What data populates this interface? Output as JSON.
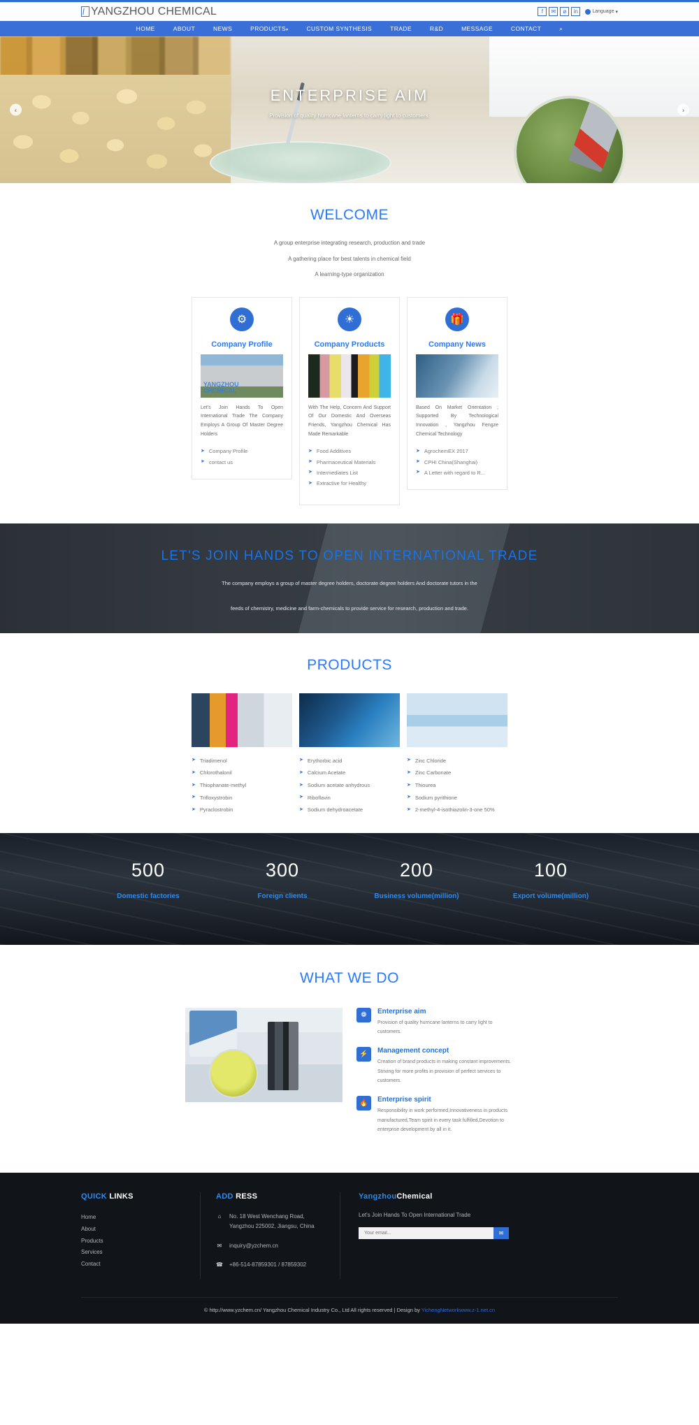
{
  "header": {
    "logo_text": "YANGZHOU CHEMICAL",
    "logo_icon": "document-pen-icon",
    "social": [
      {
        "name": "facebook-icon",
        "glyph": "f"
      },
      {
        "name": "twitter-icon",
        "glyph": "✉"
      },
      {
        "name": "pinterest-icon",
        "glyph": "ø"
      },
      {
        "name": "linkedin-icon",
        "glyph": "in"
      }
    ],
    "language_label": "Language",
    "language_caret": "▾"
  },
  "nav": {
    "items": [
      {
        "label": "HOME"
      },
      {
        "label": "ABOUT"
      },
      {
        "label": "NEWS"
      },
      {
        "label": "PRODUCTS",
        "caret": "▾"
      },
      {
        "label": "CUSTOM SYNTHESIS"
      },
      {
        "label": "TRADE"
      },
      {
        "label": "R&D"
      },
      {
        "label": "MESSAGE"
      },
      {
        "label": "CONTACT"
      }
    ],
    "search_icon": "⌕"
  },
  "hero": {
    "title": "ENTERPRISE AIM",
    "subtitle": "Provision of quality hurricane lanterns to carry light to customers.",
    "prev": "‹",
    "next": "›"
  },
  "welcome": {
    "title": "WELCOME",
    "lines": [
      "A group enterprise integrating research, production and trade",
      "A gathering place for best talents in chemical field",
      "A learning-type organization"
    ]
  },
  "cards": [
    {
      "icon": "gear-icon",
      "glyph": "⚙",
      "title": "Company Profile",
      "image": "office-building-photo",
      "desc": "Let's Join Hands To Open International Trade The Company Employs A Group Of Master Degree Holders",
      "links": [
        "Company Profile",
        "contact us"
      ]
    },
    {
      "icon": "sun-gear-icon",
      "glyph": "☀",
      "title": "Company Products",
      "image": "colorful-flasks-photo",
      "desc": "With The Help, Concern And Support Of Our Domestic And Overseas Friends, Yangzhou Chemical Has Made Remarkable",
      "links": [
        "Food Additives",
        "Pharmaceutical Materials",
        "Intermediates List",
        "Extractive for Healthy"
      ]
    },
    {
      "icon": "gift-icon",
      "glyph": "🎁",
      "title": "Company News",
      "image": "lab-glassware-photo",
      "desc": "Based On Market Orientation ; Supported By Technological Innovation , Yangzhou Fengze Chemical Technology",
      "links": [
        "AgrochemEX 2017",
        "CPHI China(Shanghai)",
        "A Letter with regard to R..."
      ]
    }
  ],
  "banner": {
    "title": "LET'S JOIN HANDS TO OPEN INTERNATIONAL TRADE",
    "lines": [
      "The company employs a group of master degree holders, doctorate degree holders And doctorate tutors in the",
      "feeds of chemistry, medicine and farm-chemicals to provide service for research, production and trade."
    ]
  },
  "products": {
    "title": "PRODUCTS",
    "columns": [
      {
        "image": "test-tubes-photo",
        "items": [
          "Triadimenol",
          "Chlorothalonil",
          "Thiophanate-methyl",
          "Trifloxystrobin",
          "Pyraclostrobin"
        ]
      },
      {
        "image": "gloved-hand-flask-photo",
        "items": [
          "Erythorbic acid",
          "Calcium Acetate",
          "Sodium acetate anhydrous",
          "Riboflavin",
          "Sodium dehydroacetate"
        ]
      },
      {
        "image": "plant-test-tubes-photo",
        "items": [
          "Zinc Chloride",
          "Zinc Carbonate",
          "Thiourea",
          "Sodium pyrithione",
          "2-methyl-4-isothiazolin-3-one 50%"
        ]
      }
    ]
  },
  "stats": [
    {
      "number": "500",
      "label": "Domestic factories"
    },
    {
      "number": "300",
      "label": "Foreign clients"
    },
    {
      "number": "200",
      "label": "Business volume(million)"
    },
    {
      "number": "100",
      "label": "Export volume(million)"
    }
  ],
  "what_we_do": {
    "title": "WHAT WE DO",
    "image": "scientist-microscope-photo",
    "items": [
      {
        "icon": "lightbulb-icon",
        "glyph": "❁",
        "heading": "Enterprise aim",
        "text": "Provision of quality hurricane lanterns to carry light to customers."
      },
      {
        "icon": "bolt-icon",
        "glyph": "⚡",
        "heading": "Management concept",
        "text": "Creation of brand products in making constant improvements. Striving for more profits in provision of perfect services to customers."
      },
      {
        "icon": "flame-icon",
        "glyph": "🔥",
        "heading": "Enterprise spirit",
        "text": "Responsibility in work performed,Innovativeness in products manufactured,Team spirit in every task fulfilled,Devotion to enterprise development by all in it."
      }
    ]
  },
  "footer": {
    "quick_links": {
      "heading_a": "QUICK",
      "heading_b": "LINKS",
      "items": [
        "Home",
        "About",
        "Products",
        "Services",
        "Contact"
      ]
    },
    "address": {
      "heading_a": "ADD",
      "heading_b": "RESS",
      "rows": [
        {
          "icon": "home-icon",
          "glyph": "⌂",
          "text": "No. 18 West Wenchang Road, Yangzhou 225002, Jiangsu, China"
        },
        {
          "icon": "envelope-icon",
          "glyph": "✉",
          "text": "inquiry@yzchem.cn"
        },
        {
          "icon": "phone-icon",
          "glyph": "☎",
          "text": "+86-514-87859301 / 87859302"
        }
      ]
    },
    "newsletter": {
      "heading_a": "Yangzhou",
      "heading_b": "Chemical",
      "slogan": "Let's Join Hands To Open International Trade",
      "placeholder": "Your email...",
      "submit_glyph": "✉"
    },
    "copyright": "© http://www.yzchem.cn/ Yangzhou Chemical Industry Co., Ltd All rights reserved | Design by ",
    "design_link": "YichengNetworkwww.z-1.net.cn"
  },
  "colors": {
    "accent": "#2f6ed4",
    "link_blue": "#2979ff",
    "nav_blue": "#3a6fd8",
    "footer_bg": "#111418"
  }
}
